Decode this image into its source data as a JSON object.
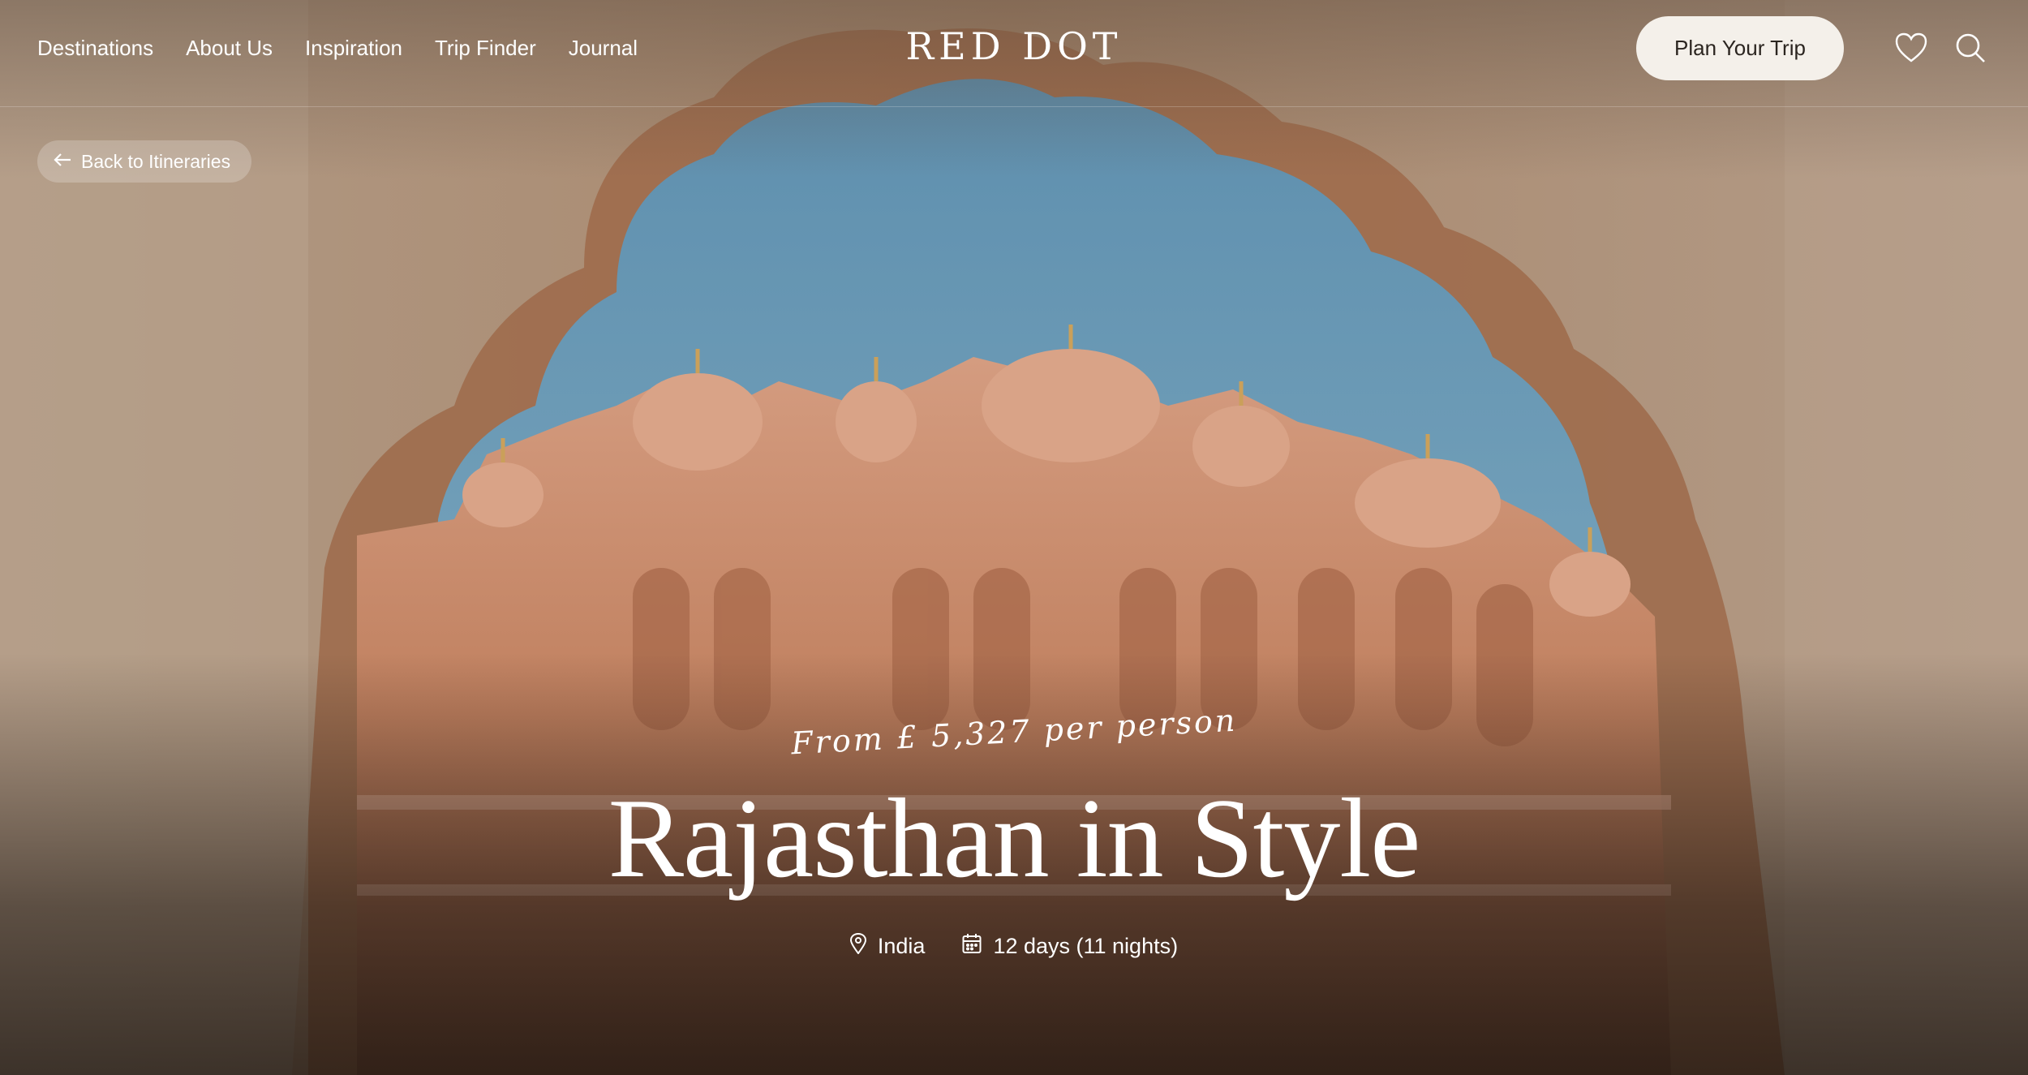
{
  "nav": {
    "items": [
      {
        "label": "Destinations"
      },
      {
        "label": "About Us"
      },
      {
        "label": "Inspiration"
      },
      {
        "label": "Trip Finder"
      },
      {
        "label": "Journal"
      }
    ]
  },
  "brand": {
    "logo": "RED DOT"
  },
  "header": {
    "cta_label": "Plan Your Trip",
    "icons": [
      "heart-icon",
      "search-icon"
    ]
  },
  "back": {
    "label": "Back to Itineraries",
    "icon": "arrow-left-icon"
  },
  "hero": {
    "price": "From £ 5,327 per person",
    "title": "Rajasthan in Style",
    "location": "India",
    "location_icon": "map-pin-icon",
    "duration": "12 days (11 nights)",
    "duration_icon": "calendar-icon"
  },
  "colors": {
    "button_bg": "#f4f0ea",
    "button_text": "#2b2520",
    "sky": "#6e9fb8",
    "palace": "#c98a6a"
  }
}
